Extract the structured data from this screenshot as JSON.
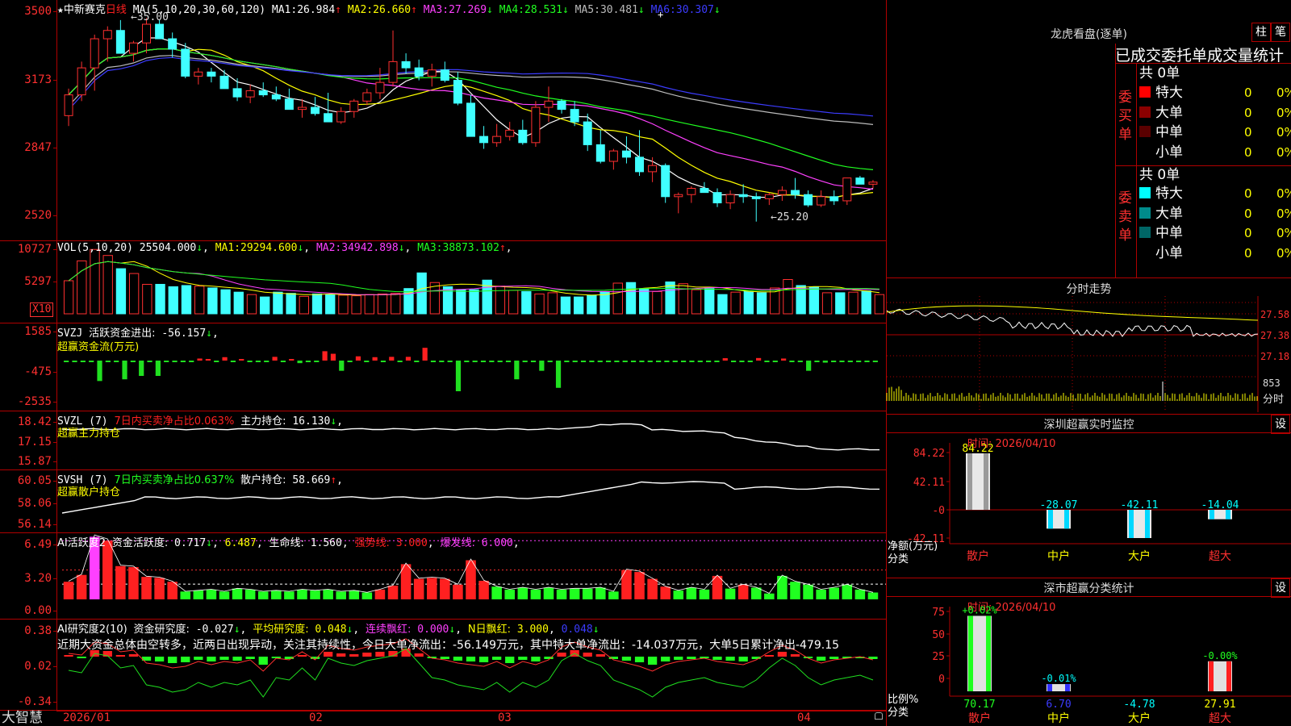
{
  "stock": {
    "star": "★",
    "name": "中新赛克",
    "period": "日线"
  },
  "kline": {
    "y_labels": [
      "3500",
      "3173",
      "2847",
      "2520"
    ],
    "ma_header": "MA(5,10,20,30,60,120)",
    "mas": [
      {
        "label": "MA1:",
        "value": "26.984",
        "arrow": "↑",
        "color": "#ffffff"
      },
      {
        "label": "MA2:",
        "value": "26.660",
        "arrow": "↑",
        "color": "#ffff00"
      },
      {
        "label": "MA3:",
        "value": "27.269",
        "arrow": "↓",
        "color": "#ff40ff"
      },
      {
        "label": "MA4:",
        "value": "28.531",
        "arrow": "↓",
        "color": "#20ff20"
      },
      {
        "label": "MA5:",
        "value": "30.481",
        "arrow": "↓",
        "color": "#bbbbbb"
      },
      {
        "label": "MA6:",
        "value": "30.307",
        "arrow": "↓",
        "color": "#3c3cff"
      }
    ],
    "high_marker": "←35.00",
    "low_marker": "←25.20",
    "candles": [
      [
        30.3,
        31.6,
        29.8,
        31.3
      ],
      [
        31.3,
        32.9,
        31.0,
        32.6
      ],
      [
        32.6,
        34.2,
        31.5,
        34.0
      ],
      [
        34.0,
        34.6,
        32.9,
        34.4
      ],
      [
        34.4,
        34.9,
        33.3,
        33.3
      ],
      [
        33.3,
        33.9,
        32.9,
        33.8
      ],
      [
        33.8,
        35.0,
        33.3,
        34.7
      ],
      [
        34.7,
        34.9,
        34.0,
        34.0
      ],
      [
        34.0,
        34.3,
        33.1,
        33.5
      ],
      [
        33.5,
        33.8,
        32.1,
        32.2
      ],
      [
        32.2,
        32.6,
        31.8,
        32.4
      ],
      [
        32.4,
        32.6,
        31.9,
        32.2
      ],
      [
        32.2,
        32.5,
        31.6,
        31.6
      ],
      [
        31.6,
        32.1,
        31.0,
        31.2
      ],
      [
        31.2,
        31.8,
        30.9,
        31.5
      ],
      [
        31.5,
        31.9,
        31.2,
        31.3
      ],
      [
        31.3,
        31.7,
        31.0,
        31.1
      ],
      [
        31.1,
        31.6,
        30.6,
        30.6
      ],
      [
        30.6,
        31.1,
        30.2,
        30.7
      ],
      [
        30.7,
        31.2,
        30.3,
        30.4
      ],
      [
        30.4,
        31.4,
        30.1,
        30.0
      ],
      [
        30.0,
        30.7,
        29.9,
        30.5
      ],
      [
        30.5,
        31.1,
        30.2,
        31.0
      ],
      [
        31.0,
        31.6,
        30.8,
        31.4
      ],
      [
        31.4,
        32.6,
        31.1,
        31.9
      ],
      [
        31.9,
        34.4,
        31.7,
        32.9
      ],
      [
        32.9,
        33.3,
        32.3,
        32.6
      ],
      [
        32.6,
        33.0,
        32.0,
        32.2
      ],
      [
        32.2,
        32.8,
        31.7,
        32.5
      ],
      [
        32.5,
        32.9,
        31.9,
        32.0
      ],
      [
        32.0,
        32.4,
        30.8,
        30.9
      ],
      [
        30.9,
        31.3,
        29.3,
        29.3
      ],
      [
        29.3,
        29.8,
        28.7,
        29.0
      ],
      [
        29.0,
        29.9,
        28.8,
        29.3
      ],
      [
        29.3,
        30.0,
        29.1,
        29.6
      ],
      [
        29.6,
        30.1,
        28.9,
        29.0
      ],
      [
        29.0,
        31.0,
        28.8,
        30.7
      ],
      [
        30.7,
        31.7,
        30.0,
        31.0
      ],
      [
        31.0,
        31.1,
        30.4,
        30.6
      ],
      [
        30.6,
        31.0,
        29.8,
        30.0
      ],
      [
        30.0,
        30.4,
        28.6,
        28.9
      ],
      [
        28.9,
        29.6,
        28.0,
        28.1
      ],
      [
        28.1,
        28.7,
        27.7,
        28.6
      ],
      [
        28.6,
        29.3,
        28.0,
        28.3
      ],
      [
        28.3,
        29.6,
        27.4,
        27.6
      ],
      [
        27.6,
        28.3,
        27.1,
        27.9
      ],
      [
        27.9,
        28.0,
        26.1,
        26.4
      ],
      [
        26.4,
        26.6,
        25.6,
        26.5
      ],
      [
        26.5,
        26.9,
        26.1,
        26.8
      ],
      [
        26.8,
        27.1,
        26.6,
        26.6
      ],
      [
        26.6,
        26.8,
        25.9,
        26.1
      ],
      [
        26.1,
        26.7,
        25.8,
        26.5
      ],
      [
        26.5,
        27.0,
        26.1,
        26.4
      ],
      [
        26.4,
        26.6,
        25.2,
        26.3
      ],
      [
        26.3,
        26.6,
        26.0,
        26.5
      ],
      [
        26.5,
        26.9,
        26.2,
        26.7
      ],
      [
        26.7,
        27.3,
        26.3,
        26.5
      ],
      [
        26.5,
        26.7,
        25.9,
        26.0
      ],
      [
        26.0,
        26.7,
        25.9,
        26.4
      ],
      [
        26.4,
        26.7,
        26.0,
        26.2
      ],
      [
        26.2,
        27.1,
        26.0,
        27.3
      ],
      [
        27.3,
        27.4,
        27.0,
        27.0
      ],
      [
        27.0,
        27.2,
        26.8,
        27.1
      ]
    ]
  },
  "volume": {
    "y_labels": [
      "10727",
      "5297"
    ],
    "unit_button": "X10",
    "header": "VOL(5,10,20)",
    "value": "25504.000",
    "value_arrow": "↓",
    "mas": [
      {
        "label": "MA1:",
        "value": "29294.600",
        "arrow": "↓",
        "color": "#ffff00"
      },
      {
        "label": "MA2:",
        "value": "34942.898",
        "arrow": "↓",
        "color": "#ff40ff"
      },
      {
        "label": "MA3:",
        "value": "38873.102",
        "arrow": "↑",
        "color": "#20ff20"
      }
    ],
    "bars": [
      5500,
      8800,
      10700,
      9700,
      7500,
      6700,
      4900,
      4900,
      4500,
      4700,
      4600,
      4300,
      4000,
      3600,
      3200,
      2800,
      3600,
      3400,
      2900,
      3300,
      3200,
      3100,
      3000,
      3200,
      3300,
      3400,
      4200,
      6800,
      5200,
      4500,
      4000,
      4000,
      5600,
      4600,
      3900,
      3700,
      3300,
      3500,
      2800,
      2800,
      3100,
      3700,
      5100,
      5200,
      4200,
      3700,
      5300,
      5000,
      4000,
      4200,
      3200,
      3600,
      3700,
      3500,
      4300,
      5700,
      4700,
      4500,
      3500,
      3500,
      3600,
      3800,
      3200
    ]
  },
  "svzj": {
    "y_labels": [
      "1585",
      "-475",
      "-2535"
    ],
    "name": "SVZJ",
    "line1": "活跃资金进出:",
    "value": "-56.157",
    "arrow": "↓",
    "line2": "超赢资金流(万元)",
    "values": [
      -80,
      -60,
      -50,
      -60,
      -1200,
      -90,
      -70,
      -1100,
      -80,
      -900,
      -60,
      -900,
      -70,
      -90,
      -70,
      -60,
      120,
      80,
      -80,
      200,
      -90,
      80,
      -80,
      -90,
      -70,
      220,
      -80,
      80,
      -150,
      -70,
      -60,
      550,
      400,
      -600,
      -80,
      250,
      -80,
      200,
      -60,
      220,
      -90,
      220,
      -80,
      750,
      -80,
      -80,
      -80,
      -1800,
      -90,
      -60,
      -90,
      -80,
      -80,
      -80,
      -1100,
      -80,
      -80,
      -600,
      -80,
      -1600,
      -80,
      -70,
      -70,
      -60,
      -70,
      -80,
      -80,
      -70,
      -90,
      -80,
      -70,
      -70,
      -70,
      -80,
      -80,
      -80,
      -80,
      -80,
      -80,
      140,
      -80,
      -80,
      -90,
      150,
      -90,
      -70,
      120,
      -80,
      -90,
      -600,
      -80,
      -120,
      -70,
      -70,
      -80,
      -70,
      -80,
      -80
    ]
  },
  "svzl": {
    "y_labels": [
      "18.42",
      "17.15",
      "15.87"
    ],
    "name": "SVZL (7)",
    "ratio_text": "7日内买卖净占比0.063%",
    "pos_label": "主力持仓:",
    "pos_value": "16.130",
    "arrow": "↓",
    "line2": "超赢主力持仓"
  },
  "svsh": {
    "y_labels": [
      "60.05",
      "58.06",
      "56.14"
    ],
    "name": "SVSH (7)",
    "ratio_text": "7日内买卖净占比0.637%",
    "pos_label": "散户持仓:",
    "pos_value": "58.669",
    "arrow": "↑",
    "line2": "超赢散户持仓"
  },
  "ai_active": {
    "y_labels": [
      "6.49",
      "3.20",
      "0.00"
    ],
    "name": "AI活跃度2",
    "fund_label": "资金活跃度:",
    "fund_value": "0.717",
    "fund_arrow": "↓",
    "v2": "6.487",
    "life_label": "生命线:",
    "life_value": "1.560",
    "strong_label": "强势线:",
    "strong_value": "3.000",
    "burst_label": "爆发线:",
    "burst_value": "6.000",
    "values": [
      1.8,
      2.5,
      6.4,
      6.0,
      3.4,
      3.3,
      2.3,
      2.2,
      1.8,
      0.8,
      0.9,
      1.0,
      0.8,
      1.1,
      1.0,
      0.8,
      0.9,
      0.8,
      1.0,
      0.9,
      1.0,
      0.8,
      0.9,
      0.7,
      1.0,
      1.4,
      3.6,
      2.1,
      2.2,
      2.1,
      1.5,
      4.0,
      1.9,
      1.3,
      1.0,
      1.2,
      1.0,
      1.2,
      1.0,
      1.1,
      1.1,
      1.2,
      0.8,
      3.0,
      2.8,
      2.1,
      1.3,
      0.9,
      1.2,
      1.0,
      2.4,
      1.1,
      1.5,
      1.2,
      0.6,
      2.4,
      1.8,
      1.5,
      1.0,
      1.2,
      1.5,
      1.0,
      0.7
    ],
    "colors_red_idx": [
      0,
      1,
      2,
      3,
      4,
      5,
      6,
      7,
      8,
      24,
      25,
      26,
      27,
      28,
      29,
      30,
      31,
      32,
      43,
      44,
      45,
      46,
      50,
      52
    ]
  },
  "ai_research": {
    "y_labels": [
      "0.38",
      "0.02",
      "-0.34"
    ],
    "name": "AI研究度2(10)",
    "fund_label": "资金研究度:",
    "fund_value": "-0.027",
    "fund_arrow": "↓",
    "avg_label": "平均研究度:",
    "avg_value": "0.048",
    "avg_arrow": "↓",
    "red_label": "连续飘红:",
    "red_value": "0.000",
    "red_arrow": "↓",
    "n_label": "N日飘红:",
    "n_value": "3.000",
    "last_value": "0.048",
    "last_arrow": "↓",
    "comment": "近期大资金总体由空转多，近两日出现异动，关注其持续性，今日大单净流出：-56.149万元，其中特大单净流出：-14.037万元，大单5日累计净出-479.15",
    "values": [
      0.01,
      0.0,
      0.08,
      0.07,
      0.02,
      0.03,
      -0.05,
      -0.06,
      -0.08,
      -0.07,
      -0.04,
      -0.06,
      -0.04,
      -0.05,
      -0.03,
      -0.1,
      -0.02,
      -0.03,
      0.02,
      -0.03,
      0.06,
      0.04,
      0.03,
      0.05,
      0.06,
      0.07,
      0.1,
      0.04,
      -0.02,
      -0.03,
      -0.05,
      -0.06,
      -0.07,
      -0.04,
      -0.08,
      -0.04,
      -0.06,
      -0.03,
      0.05,
      0.08,
      0.05,
      0.03,
      -0.03,
      -0.05,
      -0.07,
      -0.1,
      -0.06,
      -0.04,
      -0.03,
      -0.02,
      -0.04,
      -0.05,
      -0.06,
      -0.03,
      0.02,
      0.06,
      0.03,
      -0.02,
      -0.05,
      -0.03,
      -0.02,
      -0.01,
      -0.03
    ]
  },
  "x_axis": {
    "labels": [
      "2026/01",
      "02",
      "03",
      "04"
    ]
  },
  "brand": "大智慧",
  "right": {
    "title": "龙虎看盘(逐单)",
    "btn1": "柱",
    "btn2": "笔",
    "stats_title": "已成交委托单成交量统计",
    "buy": {
      "side_label": "委买单",
      "total": "共 0单",
      "rows": [
        {
          "label": "特大",
          "count": "0",
          "pct": "0%",
          "color": "#ff0000"
        },
        {
          "label": "大单",
          "count": "0",
          "pct": "0%",
          "color": "#8b0000"
        },
        {
          "label": "中单",
          "count": "0",
          "pct": "0%",
          "color": "#5a0000"
        },
        {
          "label": "小单",
          "count": "0",
          "pct": "0%",
          "color": ""
        }
      ]
    },
    "sell": {
      "side_label": "委卖单",
      "total": "共 0单",
      "rows": [
        {
          "label": "特大",
          "count": "0",
          "pct": "0%",
          "color": "#00ffff"
        },
        {
          "label": "大单",
          "count": "0",
          "pct": "0%",
          "color": "#008b8b"
        },
        {
          "label": "中单",
          "count": "0",
          "pct": "0%",
          "color": "#006666"
        },
        {
          "label": "小单",
          "count": "0",
          "pct": "0%",
          "color": ""
        }
      ]
    },
    "intraday": {
      "title": "分时走势",
      "price_labels": [
        "27.58",
        "27.38",
        "27.18"
      ],
      "vol_label": "853",
      "unit_label": "分时"
    },
    "sz_monitor": {
      "title": "深圳超赢实时监控",
      "btn": "设",
      "time_label": "时间: 2026/04/10",
      "y_labels": [
        "84.22",
        "42.11",
        "-0",
        "-42.11"
      ],
      "axis_label1": "净额(万元)",
      "axis_label2": "分类",
      "bars": [
        {
          "cat": "散户",
          "value": 84.22,
          "label": "84.22"
        },
        {
          "cat": "中户",
          "value": -28.07,
          "label": "-28.07"
        },
        {
          "cat": "大户",
          "value": -42.11,
          "label": "-42.11"
        },
        {
          "cat": "超大",
          "value": -14.04,
          "label": "-14.04"
        }
      ]
    },
    "sz_class": {
      "title": "深市超赢分类统计",
      "btn": "设",
      "time_label": "时间: 2026/04/10",
      "y_labels": [
        "75",
        "50",
        "25",
        "0"
      ],
      "axis_label1": "比例%",
      "axis_label2": "分类",
      "bars": [
        {
          "cat": "散户",
          "value": 70.17,
          "delta": "+0.02%",
          "label": "70.17"
        },
        {
          "cat": "中户",
          "value": 6.7,
          "delta": "-0.01%",
          "label": "6.70"
        },
        {
          "cat": "大户",
          "value": -4.78,
          "delta": "",
          "label": "-4.78"
        },
        {
          "cat": "超大",
          "value": 27.91,
          "delta": "-0.00%",
          "label": "27.91"
        }
      ]
    }
  }
}
